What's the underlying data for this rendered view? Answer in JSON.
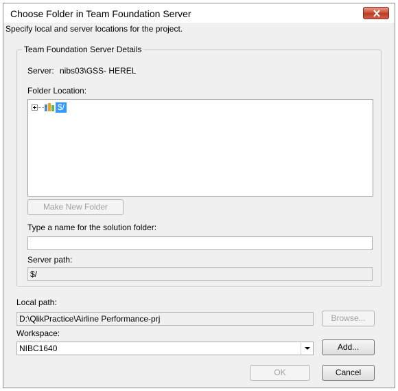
{
  "window": {
    "title": "Choose Folder in Team Foundation Server",
    "close_icon": "close-icon"
  },
  "instructions": "Specify local and server locations for the project.",
  "group": {
    "legend": "Team Foundation Server Details",
    "server_label": "Server:",
    "server_value": "nibs03\\GSS- HEREL",
    "folder_location_label": "Folder Location:",
    "tree": {
      "root_label": "$/",
      "root_icon": "team-project-collection-icon",
      "expander_icon": "plus-expander-icon",
      "selected_color": "#3399ff"
    },
    "make_new_folder_label": "Make New Folder",
    "solution_folder_label": "Type a name for the solution folder:",
    "solution_folder_value": "",
    "server_path_label": "Server path:",
    "server_path_value": "$/"
  },
  "local_path": {
    "label": "Local path:",
    "value": "D:\\QlikPractice\\Airline Performance-prj",
    "browse_label": "Browse..."
  },
  "workspace": {
    "label": "Workspace:",
    "selected": "NIBC1640",
    "add_label": "Add..."
  },
  "buttons": {
    "ok_label": "OK",
    "cancel_label": "Cancel"
  }
}
